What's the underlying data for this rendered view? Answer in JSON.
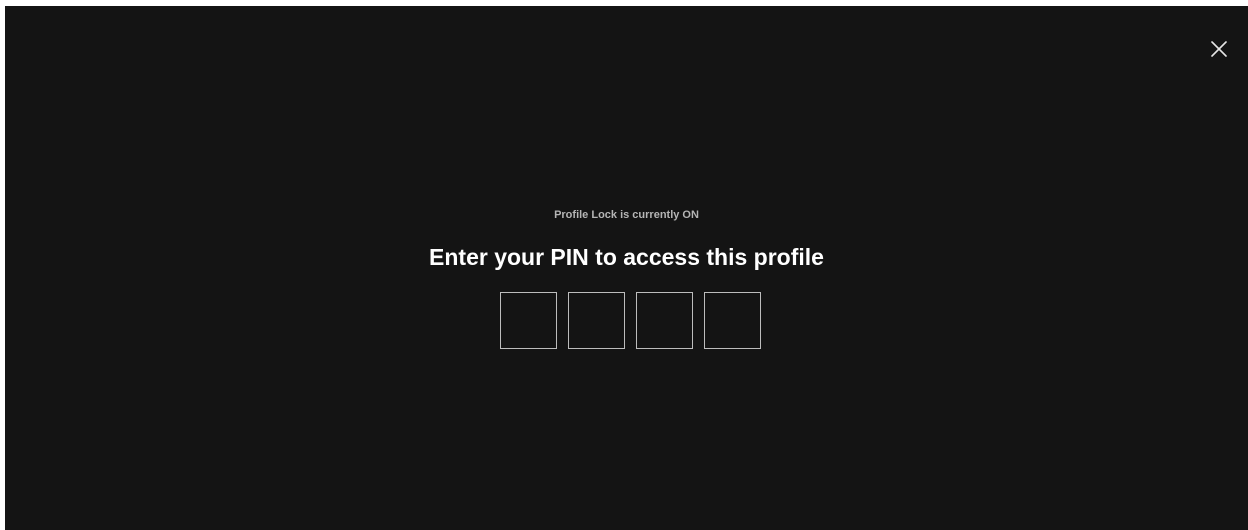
{
  "profile_lock": {
    "status_text": "Profile Lock is currently ON",
    "title": "Enter your PIN to access this profile",
    "pin_digits": [
      "",
      "",
      "",
      ""
    ]
  },
  "close_icon": "close-icon",
  "colors": {
    "background": "#141414",
    "title_text": "#ffffff",
    "status_text": "#b5b5b5",
    "pin_border": "#bdbdbd"
  }
}
